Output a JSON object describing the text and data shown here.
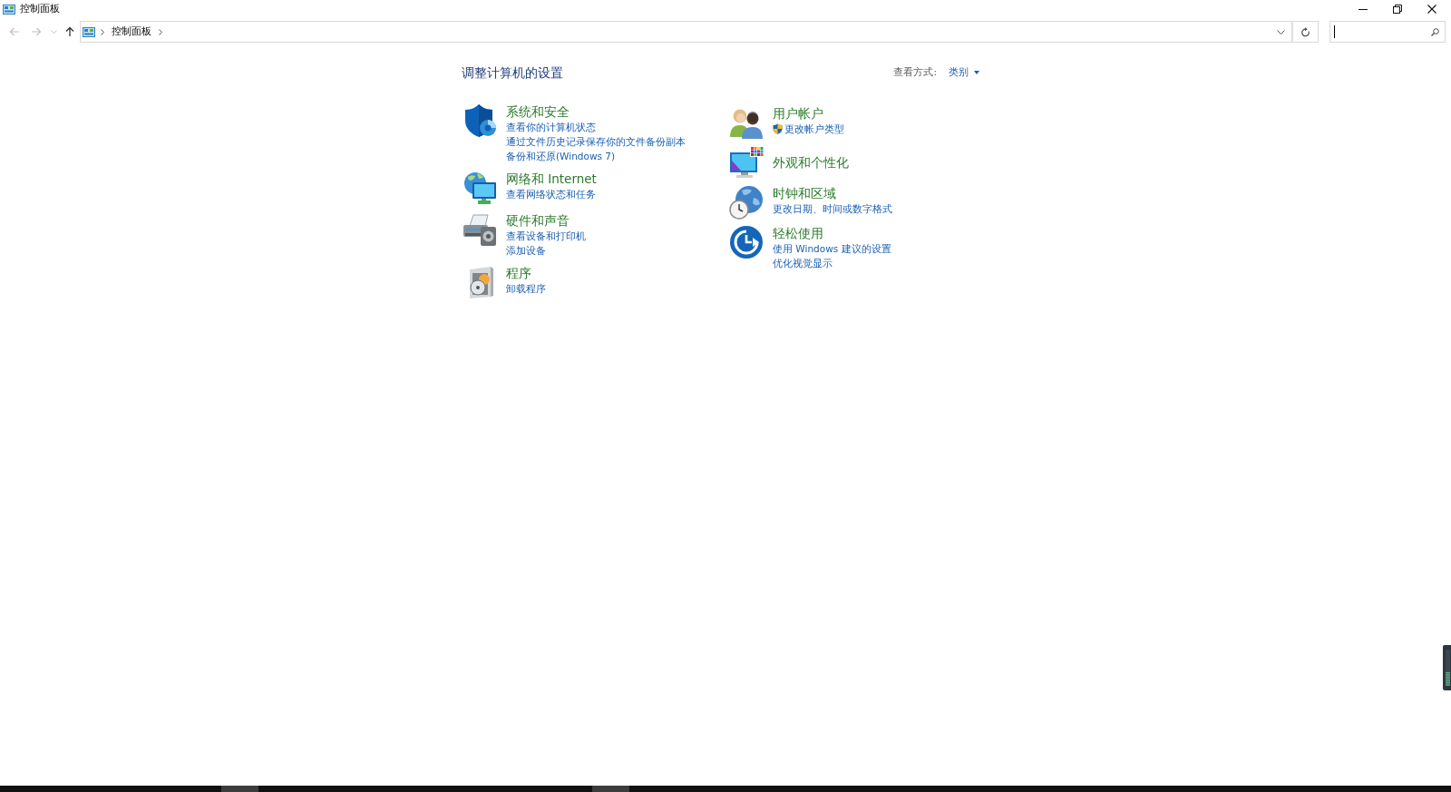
{
  "window": {
    "title": "控制面板"
  },
  "navigation": [
    {
      "disabled": true
    },
    {
      "disabled": true
    },
    {
      "disabled": true
    },
    {
      "disabled": false
    }
  ],
  "address_bar": {
    "path": [
      "控制面板"
    ]
  },
  "heading": "调整计算机的设置",
  "view_by": {
    "label": "查看方式:",
    "value": "类别"
  },
  "columns": [
    {
      "categories": [
        {
          "title": "系统和安全",
          "links": [
            {
              "text": "查看你的计算机状态",
              "elevated": false
            },
            {
              "text": "通过文件历史记录保存你的文件备份副本",
              "elevated": false
            },
            {
              "text": "备份和还原(Windows 7)",
              "elevated": false
            }
          ]
        },
        {
          "title": "网络和 Internet",
          "links": [
            {
              "text": "查看网络状态和任务",
              "elevated": false
            }
          ]
        },
        {
          "title": "硬件和声音",
          "links": [
            {
              "text": "查看设备和打印机",
              "elevated": false
            },
            {
              "text": "添加设备",
              "elevated": false
            }
          ]
        },
        {
          "title": "程序",
          "links": [
            {
              "text": "卸载程序",
              "elevated": false
            }
          ]
        }
      ]
    },
    {
      "categories": [
        {
          "title": "用户帐户",
          "links": [
            {
              "text": "更改帐户类型",
              "elevated": true
            }
          ]
        },
        {
          "title": "外观和个性化"
        },
        {
          "title": "时钟和区域",
          "links": [
            {
              "text": "更改日期、时间或数字格式",
              "elevated": false
            }
          ]
        },
        {
          "title": "轻松使用",
          "links": [
            {
              "text": "使用 Windows 建议的设置",
              "elevated": false
            },
            {
              "text": "优化视觉显示",
              "elevated": false
            }
          ]
        }
      ]
    }
  ]
}
